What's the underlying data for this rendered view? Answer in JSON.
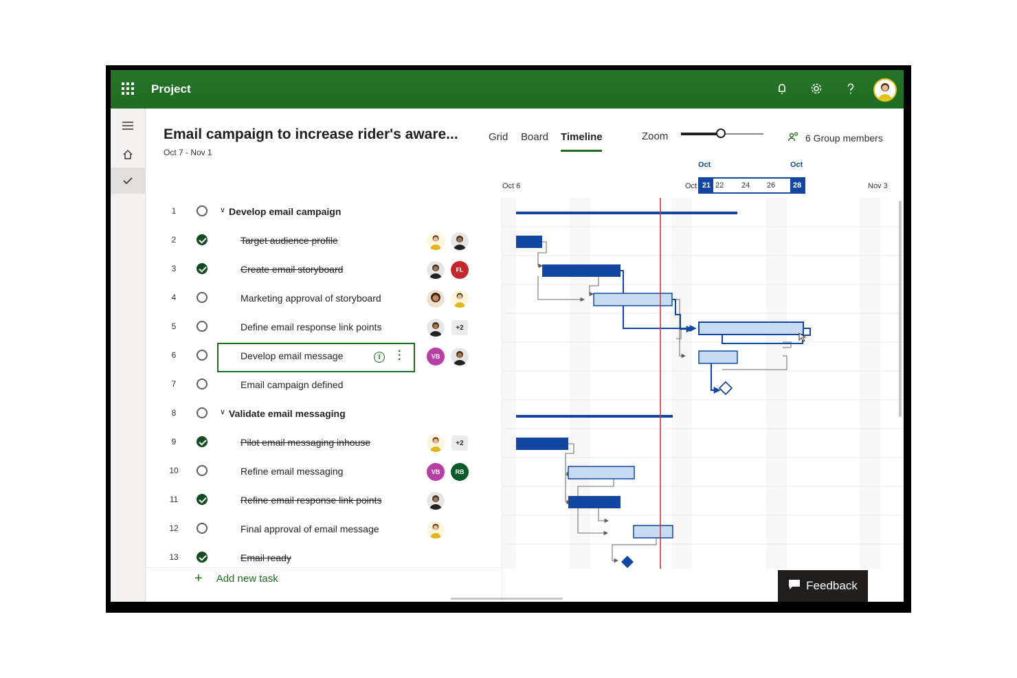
{
  "app": {
    "name": "Project"
  },
  "project": {
    "title": "Email campaign to increase rider's aware...",
    "dates": "Oct 7 - Nov 1"
  },
  "views": {
    "grid": "Grid",
    "board": "Board",
    "timeline": "Timeline",
    "active": "Timeline"
  },
  "zoom": {
    "label": "Zoom",
    "level": 0.5
  },
  "members": {
    "label": "6 Group members"
  },
  "timeline_header": {
    "month_left": "Oct",
    "month_right": "Oct",
    "start": "Oct 6",
    "oct_prefix": "Oct",
    "range_start": "21",
    "range_end": "28",
    "ticks": [
      "22",
      "24",
      "26"
    ],
    "end": "Nov 3"
  },
  "tasks": [
    {
      "num": "1",
      "name": "Develop email campaign",
      "summary": true,
      "done": false
    },
    {
      "num": "2",
      "name": "Target audience profile",
      "done": true
    },
    {
      "num": "3",
      "name": "Create email storyboard",
      "done": true
    },
    {
      "num": "4",
      "name": "Marketing approval of storyboard",
      "done": false
    },
    {
      "num": "5",
      "name": "Define email response link points",
      "done": false,
      "extra": "+2"
    },
    {
      "num": "6",
      "name": "Develop email message",
      "done": false,
      "initials_a": "VB"
    },
    {
      "num": "7",
      "name": "Email campaign defined",
      "done": false
    },
    {
      "num": "8",
      "name": "Validate email messaging",
      "summary": true,
      "done": false
    },
    {
      "num": "9",
      "name": "Pilot email messaging inhouse",
      "done": true,
      "extra": "+2"
    },
    {
      "num": "10",
      "name": "Refine email messaging",
      "done": false,
      "initials_a": "VB",
      "initials_b": "RB"
    },
    {
      "num": "11",
      "name": "Refine email response link points",
      "done": true
    },
    {
      "num": "12",
      "name": "Final approval of email message",
      "done": false
    },
    {
      "num": "13",
      "name": "Email ready",
      "done": true
    }
  ],
  "avatars": {
    "ft": "FL"
  },
  "add_task": "Add new task",
  "feedback": "Feedback",
  "colors": {
    "brand_green": "#1f6b22",
    "bar_done": "#1346a0",
    "bar_todo": "#c7dcf3",
    "today_line": "#d13438"
  }
}
